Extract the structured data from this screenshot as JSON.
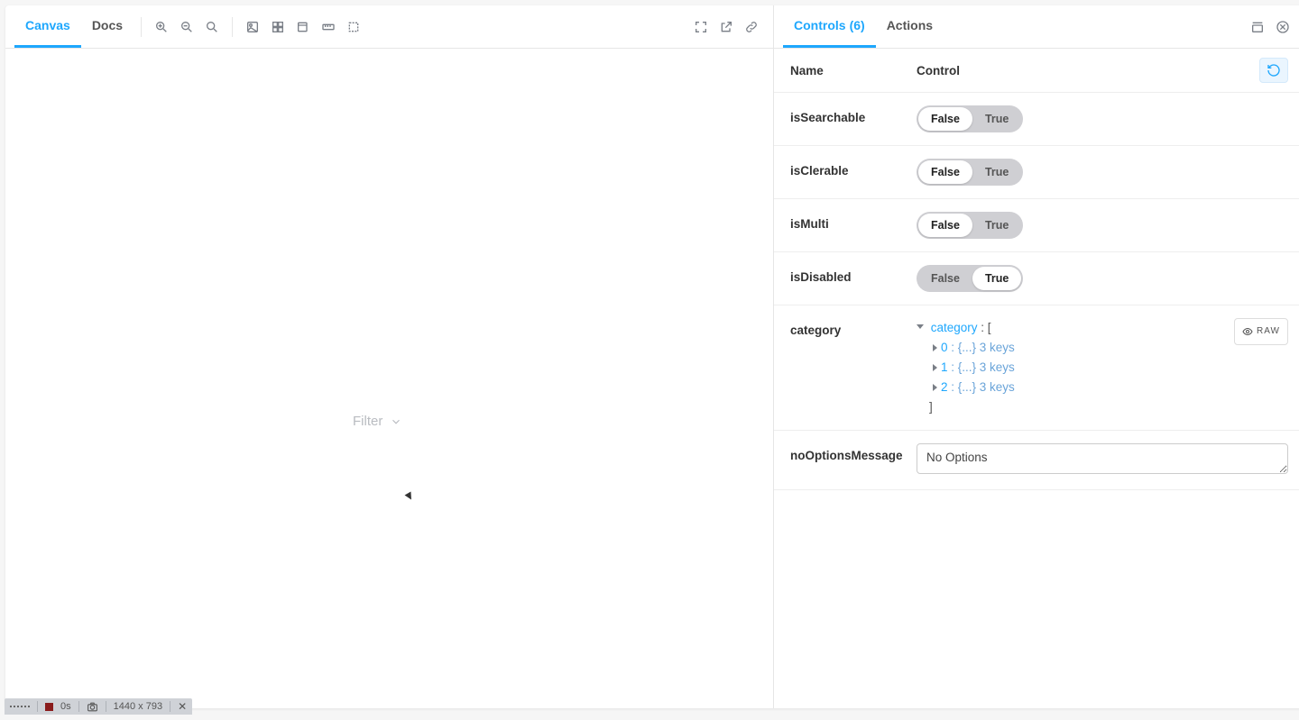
{
  "left_toolbar": {
    "tabs": [
      {
        "label": "Canvas",
        "active": true
      },
      {
        "label": "Docs",
        "active": false
      }
    ]
  },
  "canvas": {
    "filter_label": "Filter"
  },
  "right_toolbar": {
    "tabs": [
      {
        "label": "Controls",
        "count": "(6)",
        "active": true
      },
      {
        "label": "Actions",
        "active": false
      }
    ]
  },
  "controls": {
    "header": {
      "name": "Name",
      "control": "Control"
    },
    "rows": [
      {
        "name": "isSearchable",
        "type": "bool",
        "value": false,
        "false": "False",
        "true": "True"
      },
      {
        "name": "isClerable",
        "type": "bool",
        "value": false,
        "false": "False",
        "true": "True"
      },
      {
        "name": "isMulti",
        "type": "bool",
        "value": false,
        "false": "False",
        "true": "True"
      },
      {
        "name": "isDisabled",
        "type": "bool",
        "value": true,
        "false": "False",
        "true": "True"
      },
      {
        "name": "category",
        "type": "object",
        "tree": {
          "key": "category",
          "open_bracket": " : [",
          "items": [
            {
              "idx": "0",
              "summary": " : {...} 3 keys"
            },
            {
              "idx": "1",
              "summary": " : {...} 3 keys"
            },
            {
              "idx": "2",
              "summary": " : {...} 3 keys"
            }
          ],
          "close_bracket": "]"
        },
        "raw_label": "RAW"
      },
      {
        "name": "noOptionsMessage",
        "type": "text",
        "value": "No Options"
      }
    ]
  },
  "recbar": {
    "time": "0s",
    "dims": "1440 x 793"
  }
}
